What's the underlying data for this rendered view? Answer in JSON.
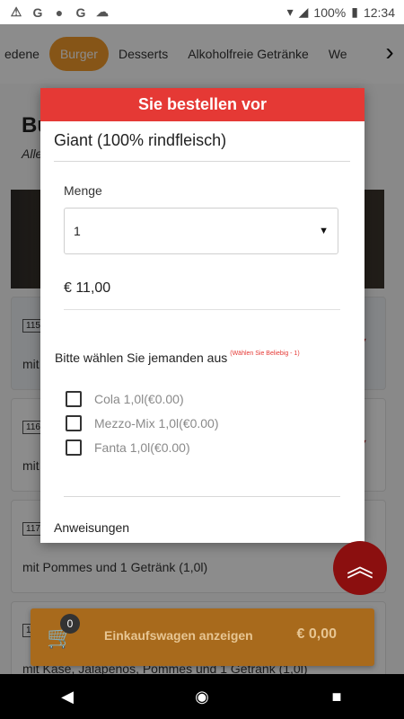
{
  "status_bar": {
    "battery": "100%",
    "time": "12:34",
    "notif_g1": "G",
    "notif_g2": "G"
  },
  "categories": {
    "items": [
      "edene",
      "Burger",
      "Desserts",
      "Alkoholfreie Getränke",
      "We"
    ],
    "active_index": 1
  },
  "background": {
    "title": "Bu",
    "subtitle": "Alle",
    "cards": [
      {
        "number": "115",
        "desc": "mit"
      },
      {
        "number": "116",
        "desc": "mit"
      },
      {
        "number": "117",
        "desc": "mit Pommes und 1 Getränk (1,0l)"
      },
      {
        "number": "1",
        "desc": "mit Käse, Jalapenos, Pommes und 1 Getränk (1,0l)"
      }
    ]
  },
  "modal": {
    "header": "Sie bestellen vor",
    "item_name": "Giant (100% rindfleisch)",
    "quantity_label": "Menge",
    "quantity_value": "1",
    "price": "€ 11,00",
    "choose_label": "Bitte wählen Sie jemanden aus",
    "choose_hint": "(Wählen Sie Beliebig - 1)",
    "options": [
      {
        "label": "Cola 1,0l(€0.00)",
        "checked": false
      },
      {
        "label": "Mezzo-Mix 1,0l(€0.00)",
        "checked": false
      },
      {
        "label": "Fanta 1,0l(€0.00)",
        "checked": false
      }
    ],
    "instructions_label": "Anweisungen"
  },
  "cart": {
    "count": "0",
    "label": "Einkaufswagen anzeigen",
    "total": "€ 0,00"
  },
  "colors": {
    "accent_orange": "#f59b2a",
    "header_red": "#e53935",
    "fab_red": "#8b0f0f"
  }
}
